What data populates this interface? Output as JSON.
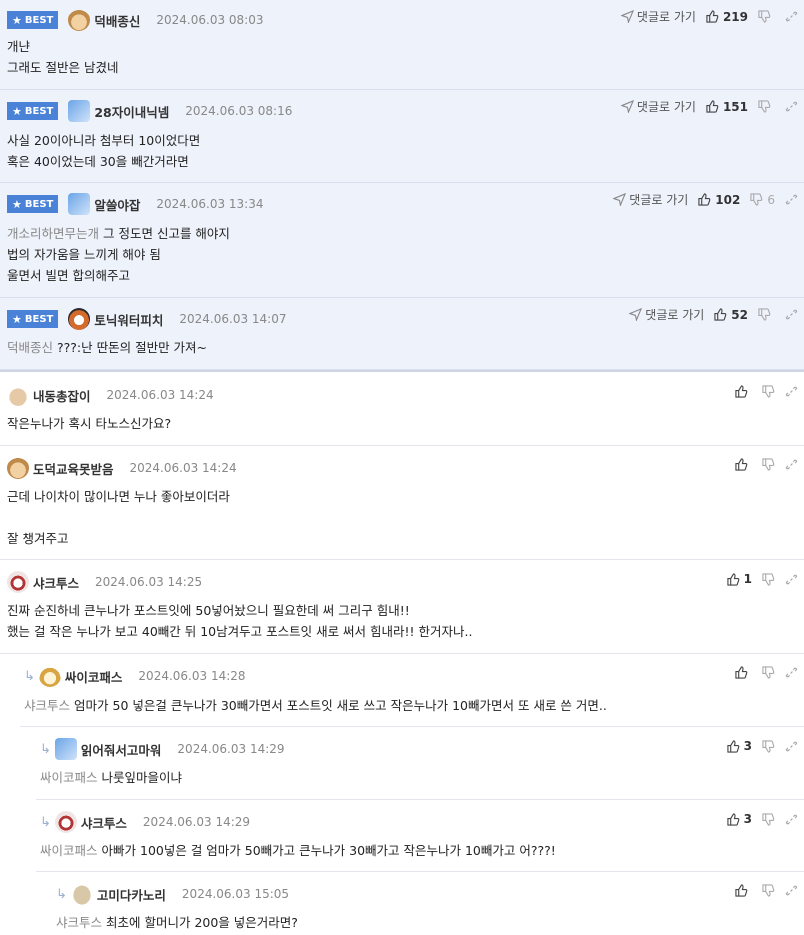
{
  "best_badge_label": "BEST",
  "reply_link_label": "댓글로 가기",
  "colors": {
    "best_bg": "#eef2fb",
    "badge": "#4a82d8"
  },
  "comments": [
    {
      "best": true,
      "avatar": "dog-avatar",
      "author": "덕배종신",
      "date": "2024.06.03 08:03",
      "likes": "219",
      "dislikes": "",
      "mention": "",
      "body": "개냔\n그래도 절반은 남겼네"
    },
    {
      "best": true,
      "avatar": "blue-avatar",
      "author": "28자이내닉넴",
      "date": "2024.06.03 08:16",
      "likes": "151",
      "dislikes": "",
      "mention": "",
      "body": "사실 20이아니라 첨부터 10이었다면\n혹은 40이었는데 30을 빼간거라면"
    },
    {
      "best": true,
      "avatar": "blue-avatar",
      "author": "알쓸야잡",
      "date": "2024.06.03 13:34",
      "likes": "102",
      "dislikes": "6",
      "mention": "개소리하면무는개",
      "body": "그 정도면 신고를 해야지\n법의 자가움을 느끼게 해야 됨\n울면서 빌면 합의해주고"
    },
    {
      "best": true,
      "avatar": "bear-avatar",
      "author": "토닉워터피치",
      "date": "2024.06.03 14:07",
      "likes": "52",
      "dislikes": "",
      "mention": "덕배종신",
      "body": "???:난 딴돈의 절반만 가져~"
    },
    {
      "best": false,
      "avatar": "rabbit-avatar",
      "author": "내동총잡이",
      "date": "2024.06.03 14:24",
      "likes": "",
      "dislikes": "",
      "mention": "",
      "body": "작은누나가 혹시 타노스신가요?"
    },
    {
      "best": false,
      "avatar": "dog-avatar",
      "author": "도덕교육못받음",
      "date": "2024.06.03 14:24",
      "likes": "",
      "dislikes": "",
      "mention": "",
      "body": "근데 나이차이 많이나면 누나 좋아보이더라\n\n잘 챙겨주고"
    },
    {
      "best": false,
      "avatar": "red-avatar",
      "author": "샤크투스",
      "date": "2024.06.03 14:25",
      "likes": "1",
      "dislikes": "",
      "mention": "",
      "body": "진짜 순진하네 큰누나가 포스트잇에 50넣어놨으니 필요한데 써 그리구 힘내!!\n했는 걸 작은 누나가 보고 40빼간 뒤 10남겨두고 포스트잇 새로 써서 힘내라!! 한거자나.."
    },
    {
      "best": false,
      "avatar": "fox-avatar",
      "author": "싸이코패스",
      "date": "2024.06.03 14:28",
      "likes": "",
      "dislikes": "",
      "mention": "샤크투스",
      "body": "엄마가 50 넣은걸 큰누나가 30빼가면서 포스트잇 새로 쓰고 작은누나가 10빼가면서 또 새로 쓴 거면.."
    },
    {
      "best": false,
      "avatar": "blue-avatar",
      "author": "읽어줘서고마워",
      "date": "2024.06.03 14:29",
      "likes": "3",
      "dislikes": "",
      "mention": "싸이코패스",
      "body": "나룻잎마을이냐"
    },
    {
      "best": false,
      "avatar": "red-avatar",
      "author": "샤크투스",
      "date": "2024.06.03 14:29",
      "likes": "3",
      "dislikes": "",
      "mention": "싸이코패스",
      "body": "아빠가 100넣은 걸 엄마가 50빼가고 큰누나가 30빼가고 작은누나가 10빼가고 어???!"
    },
    {
      "best": false,
      "avatar": "blob-avatar",
      "author": "고미다카노리",
      "date": "2024.06.03 15:05",
      "likes": "",
      "dislikes": "",
      "mention": "샤크투스",
      "body": "최초에 할머니가 200을 넣은거라면?"
    }
  ]
}
